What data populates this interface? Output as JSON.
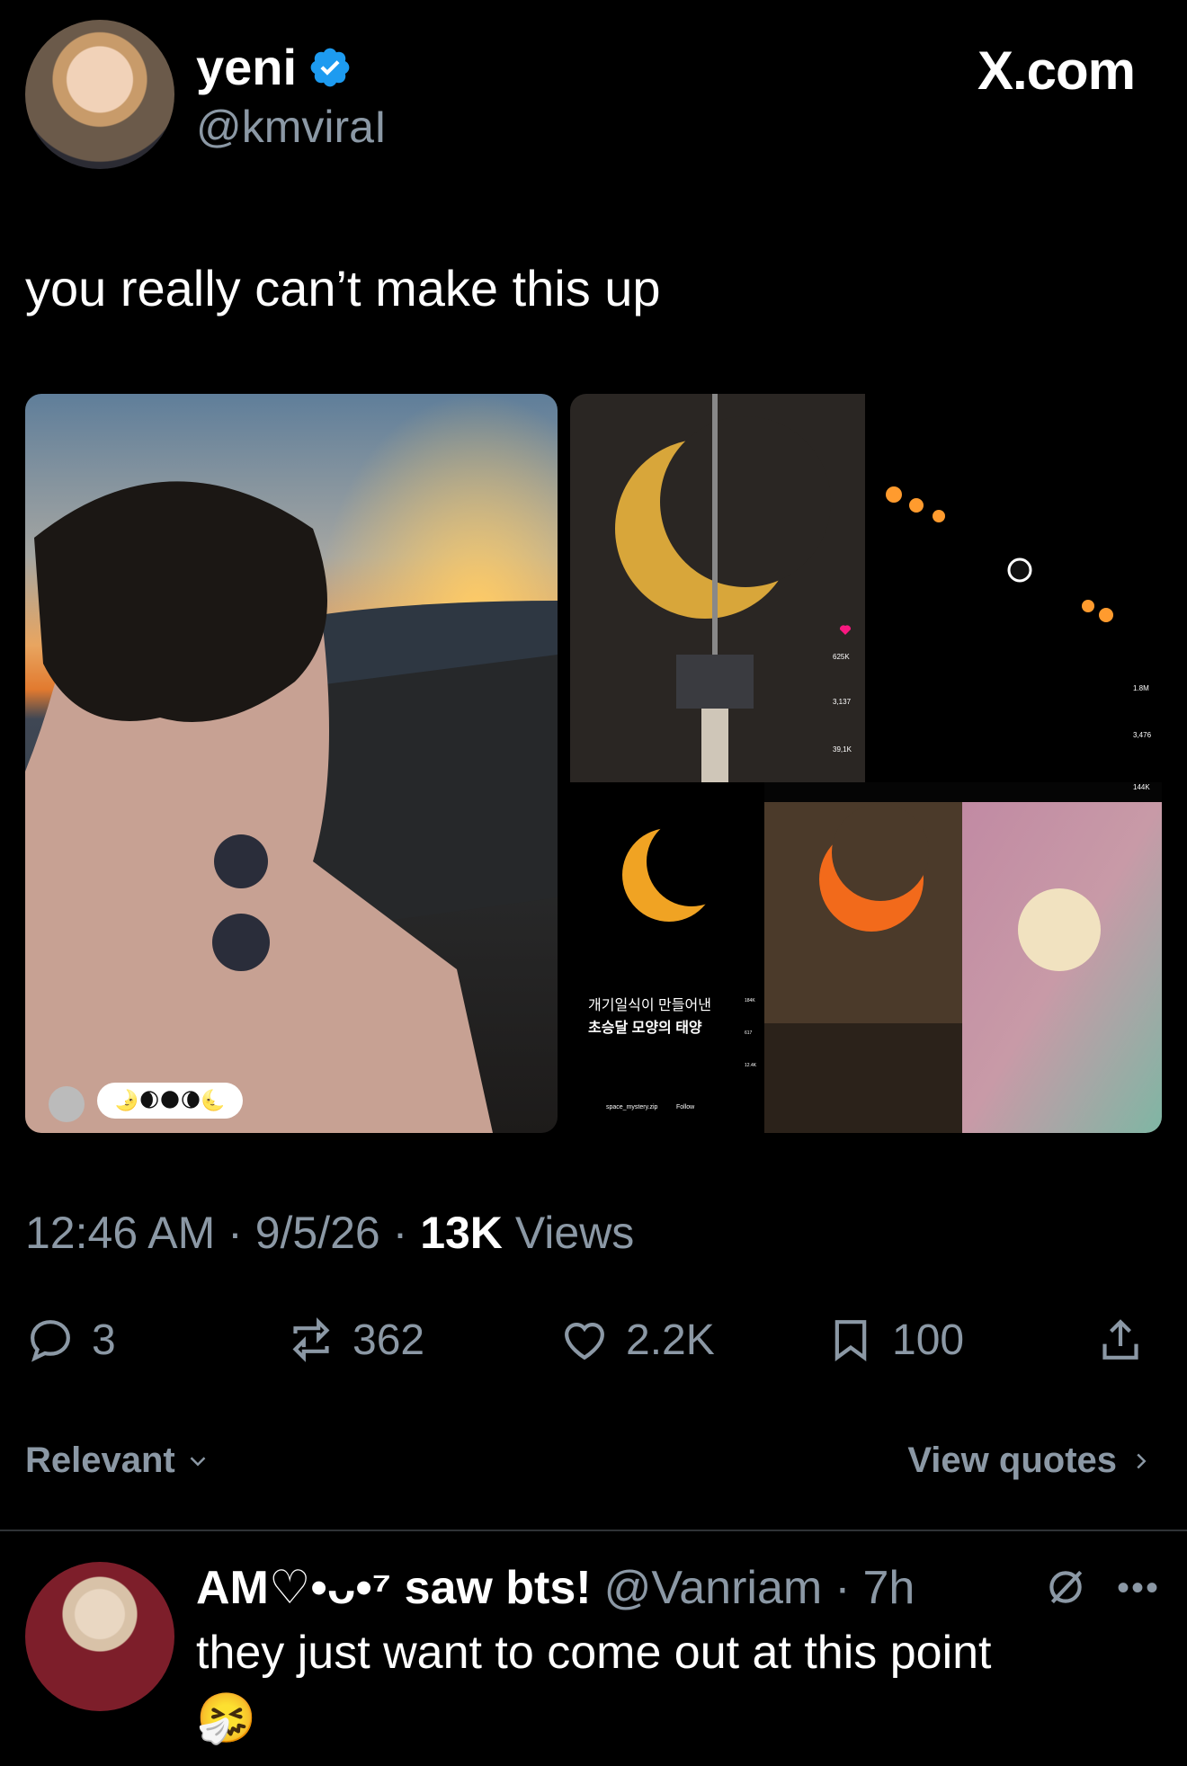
{
  "author": {
    "display_name": "yeni",
    "handle": "@kmviraI"
  },
  "brand": "X.com",
  "tweet": {
    "text": "you really can’t make this up",
    "time": "12:46 AM",
    "date": "9/5/26",
    "views_count": "13K",
    "views_label": "Views"
  },
  "media": {
    "reaction_emojis": "🌛🌒🌑🌘🌜",
    "tile_korean_line1": "개기일식이 만들어낸",
    "tile_korean_line2": "초승달 모양의 태양",
    "tile1": {
      "likes": "625K",
      "comments": "3,137",
      "reposts": "39,1K"
    },
    "tile2": {
      "likes": "1.8M",
      "comments": "3,476",
      "reposts": "144K"
    },
    "tile3": {
      "likes": "184K",
      "comments": "617",
      "reposts": "12.4K"
    },
    "tile3_user": "space_mystery.zip",
    "tile3_follow": "Follow"
  },
  "actions": {
    "replies": "3",
    "reposts": "362",
    "likes": "2.2K",
    "bookmarks": "100"
  },
  "sort": {
    "label": "Relevant",
    "view_quotes": "View quotes"
  },
  "reply": {
    "name": "AM♡•ᴗ•⁷ saw bts!",
    "handle": "@Vanriam",
    "time": "7h",
    "text": "they just want to come out at this point",
    "emoji": "🤧"
  },
  "colors": {
    "background": "#000000",
    "verified": "#1d9bf0",
    "muted": "#8b98a5",
    "like_red": "#f91880"
  }
}
